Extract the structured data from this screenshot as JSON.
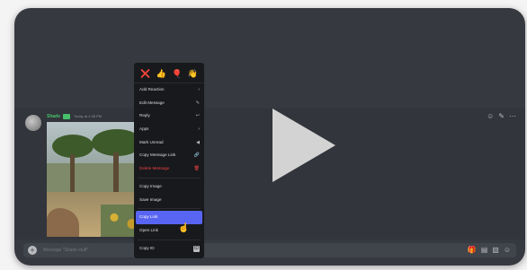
{
  "message": {
    "author": "Shade",
    "timestamp": "Today at 4:38 PM",
    "actions": [
      "add-reaction-icon",
      "edit-icon",
      "more-icon"
    ]
  },
  "context_menu": {
    "reactions": [
      "❌",
      "👍",
      "🎈",
      "👋"
    ],
    "items": [
      {
        "label": "Add Reaction",
        "icon": "›"
      },
      {
        "label": "Edit Message",
        "icon": "✎"
      },
      {
        "label": "Reply",
        "icon": "↩"
      },
      {
        "label": "Apps",
        "icon": "›"
      },
      {
        "label": "Mark Unread",
        "icon": "◀"
      },
      {
        "label": "Copy Message Link",
        "icon": "🔗"
      },
      {
        "label": "Delete Message",
        "icon": "🗑"
      },
      {
        "label": "Copy Image",
        "icon": ""
      },
      {
        "label": "Save Image",
        "icon": ""
      },
      {
        "label": "Copy Link",
        "icon": ""
      },
      {
        "label": "Open Link",
        "icon": ""
      },
      {
        "label": "Copy ID",
        "icon": "ID"
      }
    ]
  },
  "input": {
    "placeholder": "Message \"Shade stuff\""
  },
  "colors": {
    "accent": "#5865f2",
    "danger": "#ed4245",
    "username": "#46c06a"
  }
}
